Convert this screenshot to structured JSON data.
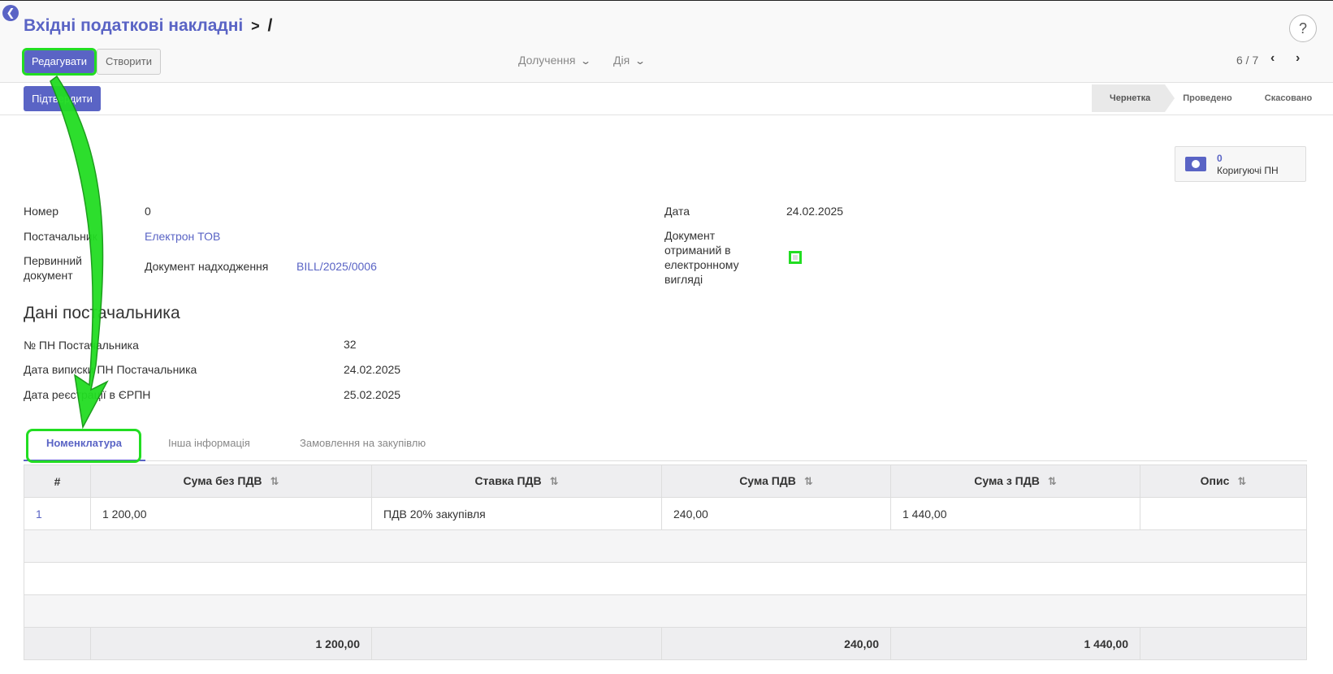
{
  "header": {
    "back_icon": "back-arrow-icon",
    "breadcrumb_parent": "Вхідні податкові накладні",
    "breadcrumb_sep": ">",
    "breadcrumb_current": "/",
    "help_label": "?"
  },
  "toolbar": {
    "edit_label": "Редагувати",
    "create_label": "Створити",
    "receive_label": "Долучення",
    "action_label": "Дія",
    "chevron": "⌄"
  },
  "pager": {
    "value": "6 / 7",
    "prev": "‹",
    "next": "›"
  },
  "statusbar": {
    "confirm_label": "Підтвердити",
    "stages": [
      "Чернетка",
      "Проведено",
      "Скасовано"
    ],
    "active_stage": "Чернетка"
  },
  "stat_button": {
    "count": "0",
    "label": "Коригуючі ПН",
    "icon": "money-icon"
  },
  "form": {
    "number_label": "Номер",
    "number_value": "0",
    "supplier_label": "Постачальник",
    "supplier_value": "Електрон ТОВ",
    "primary_doc_label": "Первинний документ",
    "receipt_doc_label": "Документ надходження",
    "receipt_doc_value": "BILL/2025/0006",
    "date_label": "Дата",
    "date_value": "24.02.2025",
    "electronic_label": "Документ отриманий в електронному вигляді",
    "electronic_checked": false
  },
  "supplier_section": {
    "title": "Дані постачальника",
    "pn_number_label": "№ ПН Постачальника",
    "pn_number_value": "32",
    "issue_date_label": "Дата виписки ПН Постачальника",
    "issue_date_value": "24.02.2025",
    "reg_date_label": "Дата реєстрації в ЄРПН",
    "reg_date_value": "25.02.2025"
  },
  "tabs": [
    "Номенклатура",
    "Інша інформація",
    "Замовлення на закупівлю"
  ],
  "table": {
    "columns": [
      "#",
      "Сума без ПДВ",
      "Ставка ПДВ",
      "Сума ПДВ",
      "Сума з ПДВ",
      "Опис"
    ],
    "sort_icon": "⇅",
    "rows": [
      [
        "1",
        "1 200,00",
        "ПДВ 20% закупівля",
        "240,00",
        "1 440,00",
        ""
      ]
    ],
    "totals": [
      "",
      "1 200,00",
      "",
      "240,00",
      "1 440,00",
      ""
    ]
  },
  "colors": {
    "accent": "#5a64c5",
    "highlight": "#22dd22"
  }
}
